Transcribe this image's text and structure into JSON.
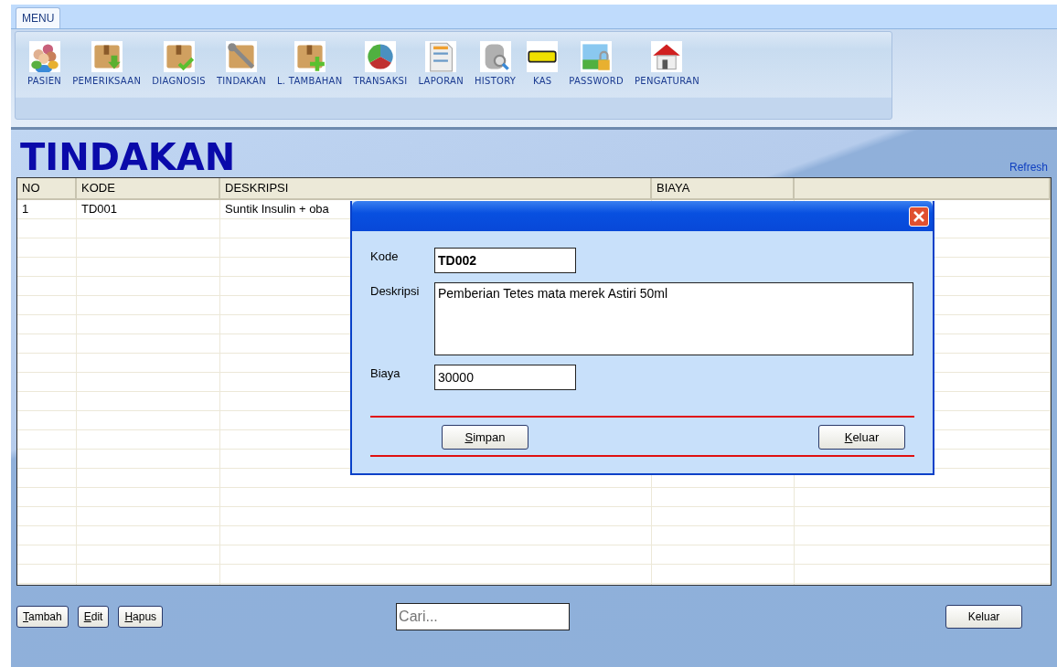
{
  "ribbon": {
    "tabs": [
      {
        "label": "MENU",
        "selected": true
      }
    ],
    "items": [
      {
        "label": "PASIEN"
      },
      {
        "label": "PEMERIKSAAN"
      },
      {
        "label": "DIAGNOSIS"
      },
      {
        "label": "TINDAKAN"
      },
      {
        "label": "L. TAMBAHAN"
      },
      {
        "label": "TRANSAKSI"
      },
      {
        "label": "LAPORAN"
      },
      {
        "label": "HISTORY"
      },
      {
        "label": "KAS"
      },
      {
        "label": "PASSWORD"
      },
      {
        "label": "PENGATURAN"
      }
    ]
  },
  "page": {
    "title": "TINDAKAN",
    "refresh_link": "Refresh"
  },
  "table": {
    "columns": [
      "NO",
      "KODE",
      "DESKRIPSI",
      "BIAYA",
      ""
    ],
    "rows": [
      [
        "1",
        "TD001",
        "Suntik Insulin + oba"
      ]
    ]
  },
  "toolbar": {
    "buttons": [
      {
        "label": "Tambah",
        "mnemonic": true
      },
      {
        "label": "Edit",
        "mnemonic": true
      },
      {
        "label": "Hapus",
        "mnemonic": true
      }
    ],
    "search": {
      "placeholder": "Cari..."
    },
    "exit_button": {
      "label": "Keluar",
      "mnemonic": false
    }
  },
  "dialog": {
    "fields": [
      {
        "kind": "text",
        "label": "Kode",
        "value": "TD002",
        "bold": true
      },
      {
        "kind": "textarea",
        "label": "Deskripsi",
        "value": "Pemberian Tetes mata merek Astiri 50ml",
        "bold": false
      },
      {
        "kind": "text",
        "label": "Biaya",
        "value": "30000",
        "bold": false
      }
    ],
    "buttons": [
      {
        "label": "Simpan",
        "mnemonic": true
      },
      {
        "label": "Keluar",
        "mnemonic": true
      }
    ]
  }
}
